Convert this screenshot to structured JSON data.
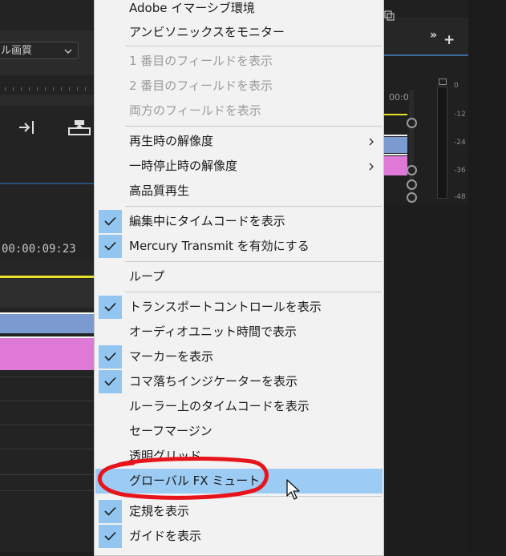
{
  "background": {
    "quality_dropdown": "ル画質",
    "timecode_left": "00:00:09:23",
    "timecode_right": "00:0",
    "meter_scale": [
      "0",
      "-12",
      "-24",
      "-36",
      "-48"
    ]
  },
  "menu": {
    "items": [
      {
        "label": "Adobe イマーシブ環境",
        "checked": false,
        "disabled": false,
        "submenu": false
      },
      {
        "label": "アンビソニックスをモニター",
        "checked": false,
        "disabled": false,
        "submenu": false
      },
      {
        "label": "1 番目のフィールドを表示",
        "checked": false,
        "disabled": true,
        "submenu": false
      },
      {
        "label": "2 番目のフィールドを表示",
        "checked": false,
        "disabled": true,
        "submenu": false
      },
      {
        "label": "両方のフィールドを表示",
        "checked": false,
        "disabled": true,
        "submenu": false
      },
      {
        "label": "再生時の解像度",
        "checked": false,
        "disabled": false,
        "submenu": true
      },
      {
        "label": "一時停止時の解像度",
        "checked": false,
        "disabled": false,
        "submenu": true
      },
      {
        "label": "高品質再生",
        "checked": false,
        "disabled": false,
        "submenu": false
      },
      {
        "label": "編集中にタイムコードを表示",
        "checked": true,
        "disabled": false,
        "submenu": false
      },
      {
        "label": "Mercury Transmit を有効にする",
        "checked": true,
        "disabled": false,
        "submenu": false
      },
      {
        "label": "ループ",
        "checked": false,
        "disabled": false,
        "submenu": false
      },
      {
        "label": "トランスポートコントロールを表示",
        "checked": true,
        "disabled": false,
        "submenu": false
      },
      {
        "label": "オーディオユニット時間で表示",
        "checked": false,
        "disabled": false,
        "submenu": false
      },
      {
        "label": "マーカーを表示",
        "checked": true,
        "disabled": false,
        "submenu": false
      },
      {
        "label": "コマ落ちインジケーターを表示",
        "checked": true,
        "disabled": false,
        "submenu": false
      },
      {
        "label": "ルーラー上のタイムコードを表示",
        "checked": false,
        "disabled": false,
        "submenu": false
      },
      {
        "label": "セーフマージン",
        "checked": false,
        "disabled": false,
        "submenu": false
      },
      {
        "label": "透明グリッド",
        "checked": false,
        "disabled": false,
        "submenu": false
      },
      {
        "label": "グローバル FX ミュート",
        "checked": false,
        "disabled": false,
        "submenu": false,
        "highlighted": true
      },
      {
        "label": "定規を表示",
        "checked": true,
        "disabled": false,
        "submenu": false
      },
      {
        "label": "ガイドを表示",
        "checked": true,
        "disabled": false,
        "submenu": false
      }
    ]
  },
  "colors": {
    "menu_bg": "#f2f2f2",
    "highlight": "#9ccbf3",
    "check_bg": "#92c6f1",
    "annotation": "#e8141c",
    "clip_blue": "#7b9ad0",
    "clip_pink": "#de79d8",
    "playhead_yellow": "#e8e02a"
  },
  "icons": [
    "chevron-down-icon",
    "insert-icon",
    "overwrite-icon",
    "double-chevron-icon",
    "plus-icon",
    "checkmark-icon",
    "submenu-arrow-icon",
    "mouse-cursor-icon"
  ]
}
